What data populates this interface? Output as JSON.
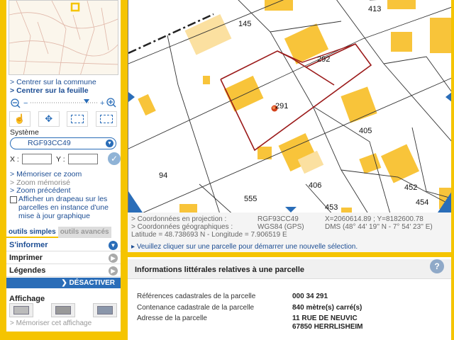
{
  "sidebar": {
    "center_commune": "Centrer sur la commune",
    "center_feuille": "Centrer sur la feuille",
    "systeme_label": "Système",
    "systeme_value": "RGF93CC49",
    "x_label": "X :",
    "y_label": "Y :",
    "memoriser_zoom": "Mémoriser ce zoom",
    "zoom_memorise": "Zoom mémorisé",
    "zoom_precedent": "Zoom précédent",
    "drapeau_text": "Afficher un drapeau sur les parcelles en instance d'une mise à jour graphique",
    "tabs": [
      "outils simples",
      "outils avancés"
    ],
    "accordion": [
      "S'informer",
      "Imprimer",
      "Légendes"
    ],
    "desactiver": "DÉSACTIVER",
    "affichage": "Affichage",
    "memoriser_affichage": "Mémoriser cet affichage"
  },
  "map": {
    "parcels": [
      "145",
      "413",
      "292",
      "291",
      "405",
      "94",
      "406",
      "555",
      "452",
      "453",
      "454"
    ]
  },
  "coords": {
    "projection_label": "Coordonnées en projection :",
    "projection_system": "RGF93CC49",
    "projection_value": "X=2060614.89 ; Y=8182600.78",
    "geo_label": "Coordonnées géographiques :",
    "geo_system": "WGS84 (GPS)",
    "geo_value": "DMS (48° 44' 19'' N - 7° 54' 23'' E)",
    "latlon": "Latitude = 48.738693 N - Longitude = 7.906519 E",
    "notice": "Veuillez cliquer sur une parcelle pour démarrer une nouvelle sélection."
  },
  "info": {
    "title": "Informations littérales relatives à une parcelle",
    "rows": [
      {
        "label": "Références cadastrales de la parcelle",
        "value": "000 34 291"
      },
      {
        "label": "Contenance cadastrale de la parcelle",
        "value": "840 mètre(s) carré(s)"
      },
      {
        "label": "Adresse de la parcelle",
        "value": "11 RUE DE NEUVIC",
        "value2": "67850 HERRLISHEIM"
      }
    ]
  }
}
